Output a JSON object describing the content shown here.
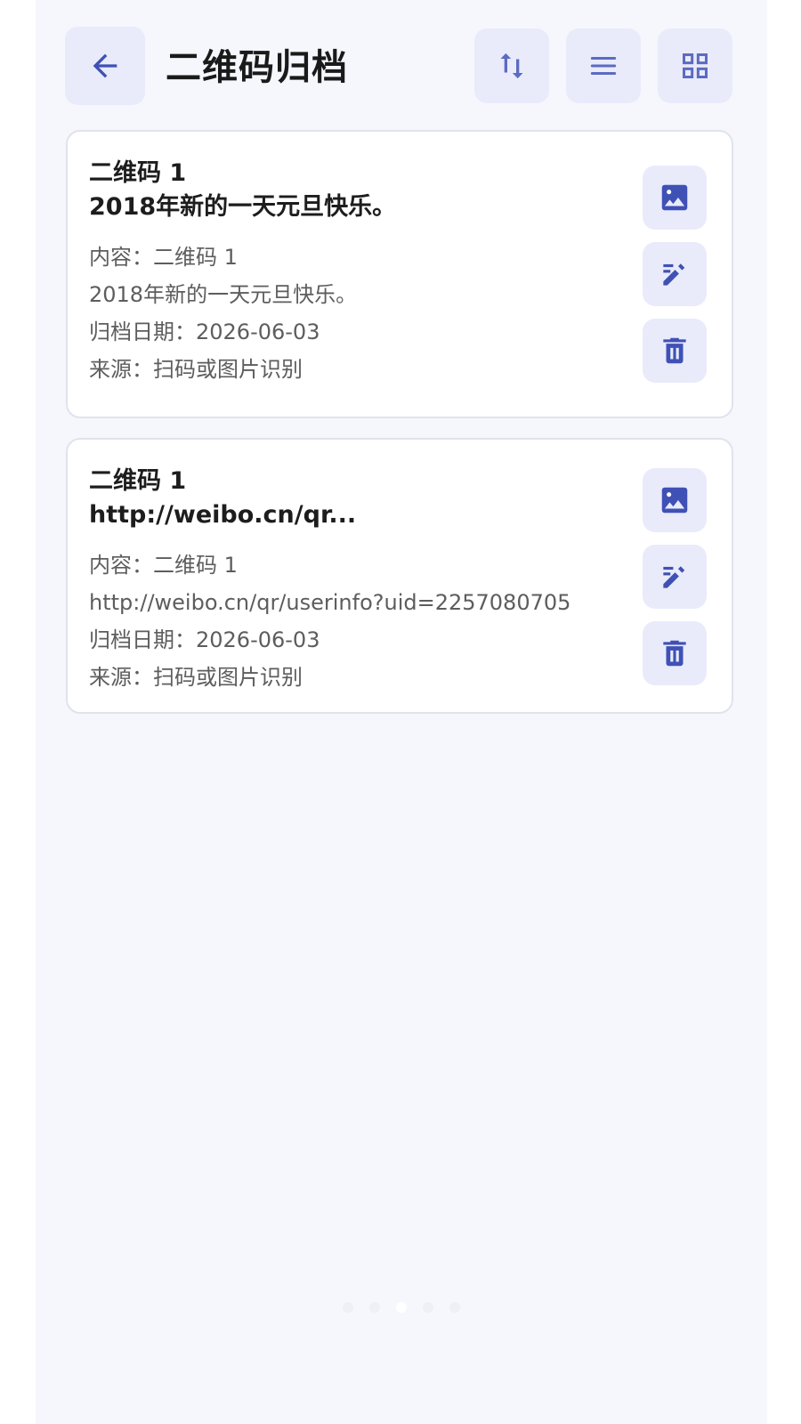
{
  "header": {
    "title": "二维码归档",
    "back_icon": "arrow-left-icon",
    "sort_icon": "sort-icon",
    "list_icon": "list-view-icon",
    "grid_icon": "grid-view-icon"
  },
  "colors": {
    "accent": "#3f51b5",
    "background": "#f5f7fc",
    "button_bg": "#e9ebfb",
    "card_border": "#dfe3ec"
  },
  "records": [
    {
      "name": "二维码 1",
      "headline": "2018年新的一天元旦快乐。",
      "content_line": "内容：二维码 1",
      "content_value": "2018年新的一天元旦快乐。",
      "date_line": "归档日期：2026-06-03",
      "source_line": "来源：扫码或图片识别"
    },
    {
      "name": "二维码 1",
      "headline": "http://weibo.cn/qr...",
      "content_line": "内容：二维码 1",
      "content_value": "http://weibo.cn/qr/userinfo?uid=2257080705",
      "date_line": "归档日期：2026-06-03",
      "source_line": "来源：扫码或图片识别"
    }
  ],
  "pagination": {
    "total": 5,
    "current": 3
  }
}
